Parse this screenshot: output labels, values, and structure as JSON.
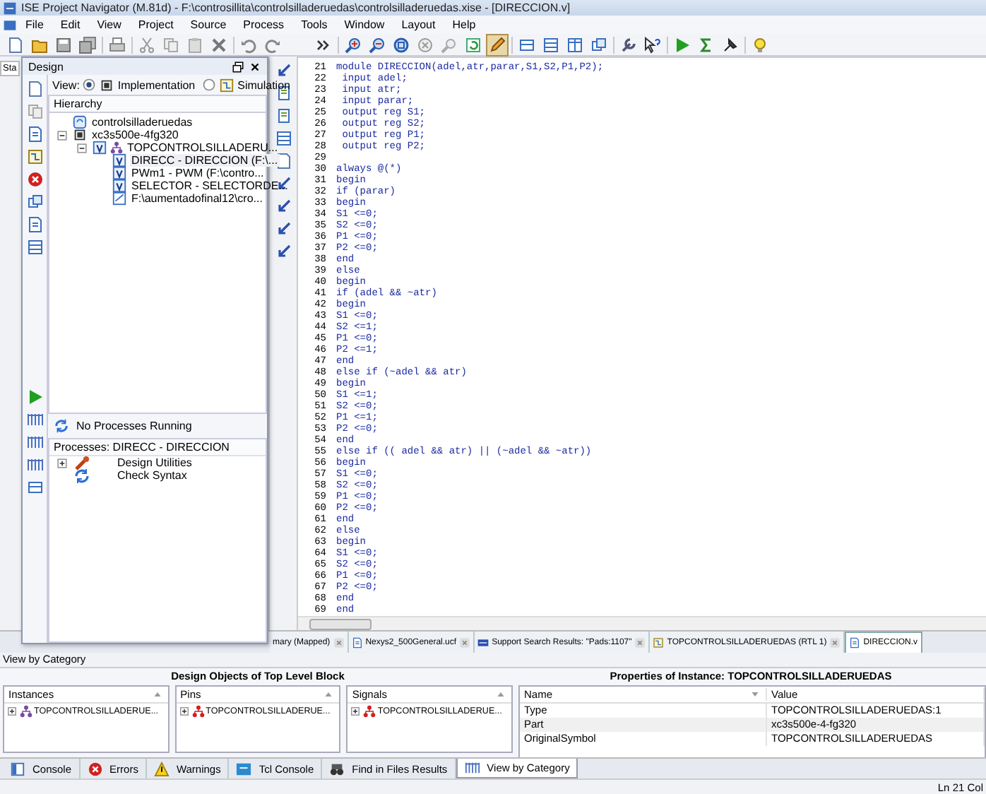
{
  "window": {
    "title": "ISE Project Navigator (M.81d) - F:\\controsillita\\controlsilladeruedas\\controlsilladeruedas.xise - [DIRECCION.v]"
  },
  "menu": [
    "File",
    "Edit",
    "View",
    "Project",
    "Source",
    "Process",
    "Tools",
    "Window",
    "Layout",
    "Help"
  ],
  "back_panel": {
    "tab": "Sta"
  },
  "design_panel": {
    "title": "Design",
    "view_label": "View:",
    "view_options": [
      {
        "label": "Implementation",
        "selected": true
      },
      {
        "label": "Simulation",
        "selected": false
      }
    ],
    "hierarchy_header": "Hierarchy",
    "hierarchy": [
      {
        "label": "controlsilladeruedas",
        "kind": "project",
        "selected": false
      },
      {
        "label": "xc3s500e-4fg320",
        "kind": "device",
        "selected": false,
        "expanded": true,
        "children": [
          {
            "label": "TOPCONTROLSILLADERU...",
            "kind": "top",
            "selected": false,
            "expanded": true,
            "children": [
              {
                "label": "DIRECC - DIRECCION (F:\\...",
                "kind": "module",
                "selected": true
              },
              {
                "label": "PWm1 - PWM (F:\\contro...",
                "kind": "module",
                "selected": false
              },
              {
                "label": "SELECTOR - SELECTORDE...",
                "kind": "module",
                "selected": false
              },
              {
                "label": "F:\\aumentadofinal12\\cro...",
                "kind": "file",
                "selected": false
              }
            ]
          }
        ]
      }
    ],
    "process_status": "No Processes Running",
    "processes_header": "Processes: DIRECC - DIRECCION",
    "processes": [
      {
        "label": "Design Utilities",
        "kind": "tools",
        "expanded": false
      },
      {
        "label": "Check Syntax",
        "kind": "check"
      }
    ]
  },
  "editor": {
    "lines": [
      {
        "number": "21",
        "text": "module DIRECCION(adel,atr,parar,S1,S2,P1,P2);"
      },
      {
        "number": "22",
        "text": " input adel;"
      },
      {
        "number": "23",
        "text": " input atr;"
      },
      {
        "number": "24",
        "text": " input parar;"
      },
      {
        "number": "25",
        "text": " output reg S1;"
      },
      {
        "number": "26",
        "text": " output reg S2;"
      },
      {
        "number": "27",
        "text": " output reg P1;"
      },
      {
        "number": "28",
        "text": " output reg P2;"
      },
      {
        "number": "29"
      },
      {
        "number": "30",
        "text": "always @(*)"
      },
      {
        "number": "31",
        "text": "begin"
      },
      {
        "number": "32",
        "text": "if (parar)"
      },
      {
        "number": "33",
        "text": "begin"
      },
      {
        "number": "34",
        "text": "S1 <=0;"
      },
      {
        "number": "35",
        "text": "S2 <=0;"
      },
      {
        "number": "36",
        "text": "P1 <=0;"
      },
      {
        "number": "37",
        "text": "P2 <=0;"
      },
      {
        "number": "38",
        "text": "end"
      },
      {
        "number": "39",
        "text": "else"
      },
      {
        "number": "40",
        "text": "begin"
      },
      {
        "number": "41",
        "text": "if (adel && ~atr)"
      },
      {
        "number": "42",
        "text": "begin"
      },
      {
        "number": "43",
        "text": "S1 <=0;"
      },
      {
        "number": "44",
        "text": "S2 <=1;"
      },
      {
        "number": "45",
        "text": "P1 <=0;"
      },
      {
        "number": "46",
        "text": "P2 <=1;"
      },
      {
        "number": "47",
        "text": "end"
      },
      {
        "number": "48",
        "text": "else if (~adel && atr)"
      },
      {
        "number": "49",
        "text": "begin"
      },
      {
        "number": "50",
        "text": "S1 <=1;"
      },
      {
        "number": "51",
        "text": "S2 <=0;"
      },
      {
        "number": "52",
        "text": "P1 <=1;"
      },
      {
        "number": "53",
        "text": "P2 <=0;"
      },
      {
        "number": "54",
        "text": "end"
      },
      {
        "number": "55",
        "text": "else if (( adel && atr) || (~adel && ~atr))"
      },
      {
        "number": "56",
        "text": "begin"
      },
      {
        "number": "57",
        "text": "S1 <=0;"
      },
      {
        "number": "58",
        "text": "S2 <=0;"
      },
      {
        "number": "59",
        "text": "P1 <=0;"
      },
      {
        "number": "60",
        "text": "P2 <=0;"
      },
      {
        "number": "61",
        "text": "end"
      },
      {
        "number": "62",
        "text": "else"
      },
      {
        "number": "63",
        "text": "begin"
      },
      {
        "number": "64",
        "text": "S1 <=0;"
      },
      {
        "number": "65",
        "text": "S2 <=0;"
      },
      {
        "number": "66",
        "text": "P1 <=0;"
      },
      {
        "number": "67",
        "text": "P2 <=0;"
      },
      {
        "number": "68",
        "text": "end"
      },
      {
        "number": "69",
        "text": "end"
      }
    ]
  },
  "editor_tabs": [
    {
      "label": "mary (Mapped)",
      "kind": "report",
      "selected": false
    },
    {
      "label": "Nexys2_500General.ucf",
      "kind": "file",
      "selected": false
    },
    {
      "label": "Support Search Results: \"Pads:1107\"",
      "kind": "web",
      "selected": false
    },
    {
      "label": "TOPCONTROLSILLADERUEDAS (RTL 1)",
      "kind": "schematic",
      "selected": false
    },
    {
      "label": "DIRECCION.v",
      "kind": "file",
      "selected": true
    }
  ],
  "view_by_category": {
    "title": "View by Category",
    "objects_header": "Design Objects of Top Level Block",
    "lists": [
      {
        "header": "Instances",
        "kind": "instance",
        "items": [
          "TOPCONTROLSILLADERUE..."
        ]
      },
      {
        "header": "Pins",
        "kind": "pin",
        "items": [
          "TOPCONTROLSILLADERUE..."
        ]
      },
      {
        "header": "Signals",
        "kind": "signal",
        "items": [
          "TOPCONTROLSILLADERUE..."
        ]
      }
    ],
    "properties_header": "Properties of Instance: TOPCONTROLSILLADERUEDAS",
    "properties_columns": [
      "Name",
      "Value"
    ],
    "properties": [
      {
        "name": "Type",
        "value": "TOPCONTROLSILLADERUEDAS:1"
      },
      {
        "name": "Part",
        "value": "xc3s500e-4-fg320"
      },
      {
        "name": "OriginalSymbol",
        "value": "TOPCONTROLSILLADERUEDAS"
      }
    ]
  },
  "bottom_tabs": [
    {
      "label": "Console",
      "kind": "console",
      "selected": false
    },
    {
      "label": "Errors",
      "kind": "errors",
      "selected": false
    },
    {
      "label": "Warnings",
      "kind": "warnings",
      "selected": false
    },
    {
      "label": "Tcl Console",
      "kind": "tcl",
      "selected": false
    },
    {
      "label": "Find in Files Results",
      "kind": "find",
      "selected": false
    },
    {
      "label": "View by Category",
      "kind": "category",
      "selected": true
    }
  ],
  "status_bar": {
    "position": "Ln 21 Col"
  }
}
